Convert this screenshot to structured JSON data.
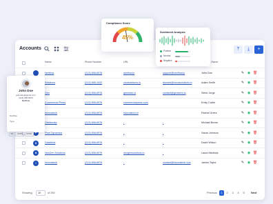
{
  "header": {
    "title": "Accounts",
    "tools": [
      "search-icon",
      "grid-icon",
      "filter-icon"
    ],
    "buttons": [
      "upload-icon",
      "download-icon",
      "plus-icon"
    ]
  },
  "table": {
    "columns": [
      "Name",
      "Phone Number",
      "URL",
      "Email",
      "Account Owner"
    ],
    "rows": [
      {
        "initial": "",
        "name": "Nexflow",
        "phone": "(213) 658-8976",
        "url": "nexflow.io",
        "email": "support@nexflow.io",
        "owner": "John Doe"
      },
      {
        "initial": "",
        "name": "Solutions",
        "phone": "(213) 658-1032",
        "url": "clovsolutions.io",
        "email": "leonard@novasolutions.io",
        "owner": "Adam Smith"
      },
      {
        "initial": "",
        "name": "Gen",
        "phone": "(213) 658-8976",
        "url": "gensean.io",
        "email": "contact@genseen.io",
        "owner": "Steve Jorge"
      },
      {
        "initial": "",
        "name": "Commercial Press",
        "phone": "(213) 658-8976",
        "url": "commercialpress.com",
        "email": "",
        "owner": "Emily Carter"
      },
      {
        "initial": "",
        "name": "Innovatech",
        "phone": "(213) 658-8976",
        "url": "innovatech.io",
        "email": "",
        "owner": "Rachel Green"
      },
      {
        "initial": "O",
        "name": "Orbitworks",
        "phone": "(213) 658-8976",
        "url": "-",
        "email": "-",
        "owner": "Michael Brown"
      },
      {
        "initial": "P",
        "name": "Pixel Dynamics",
        "phone": "(213) 658-8976",
        "url": "-",
        "email": "-",
        "owner": "Sarah Johnson"
      },
      {
        "initial": "D",
        "name": "DataNest",
        "phone": "(213) 658-8976",
        "url": "-",
        "email": "-",
        "owner": "David Wilson"
      },
      {
        "initial": "N",
        "name": "NexGen Solutions",
        "phone": "(213) 658-8976",
        "url": "nexgensolutions.io",
        "email": "-",
        "owner": "Laura Martinez"
      },
      {
        "initial": "I",
        "name": "Innovatech",
        "phone": "(213) 658-8976",
        "url": "-",
        "email": "contact@innovatech.hub",
        "owner": "James Taylor"
      }
    ]
  },
  "footer": {
    "showing_label": "Showing",
    "page_size": "10",
    "of_label": "of 250",
    "prev": "Previous",
    "pages": [
      "1",
      "2",
      "3",
      "4",
      "5"
    ],
    "active_page": "1",
    "next": "Next"
  },
  "gauge": {
    "title": "Compliance Score",
    "value": "45%",
    "level": 0.45
  },
  "sentiment": {
    "title": "Sentiment Analysis",
    "legend": [
      {
        "label": "Positive",
        "color": "#1fb36b",
        "level": 0.85
      },
      {
        "label": "Neutral",
        "color": "#9aa1b2",
        "level": 0.3
      },
      {
        "label": "Negative",
        "color": "#e24747",
        "level": 0.15
      }
    ]
  },
  "profile": {
    "name": "John Doe",
    "email": "jjohndoe@gmail.com",
    "phone": "(213) 658-8976",
    "account": "Nexflow",
    "labels": [
      "Nexflow",
      "Type"
    ],
    "tags": [
      "SIC",
      "LEADS",
      "NOTES"
    ]
  }
}
